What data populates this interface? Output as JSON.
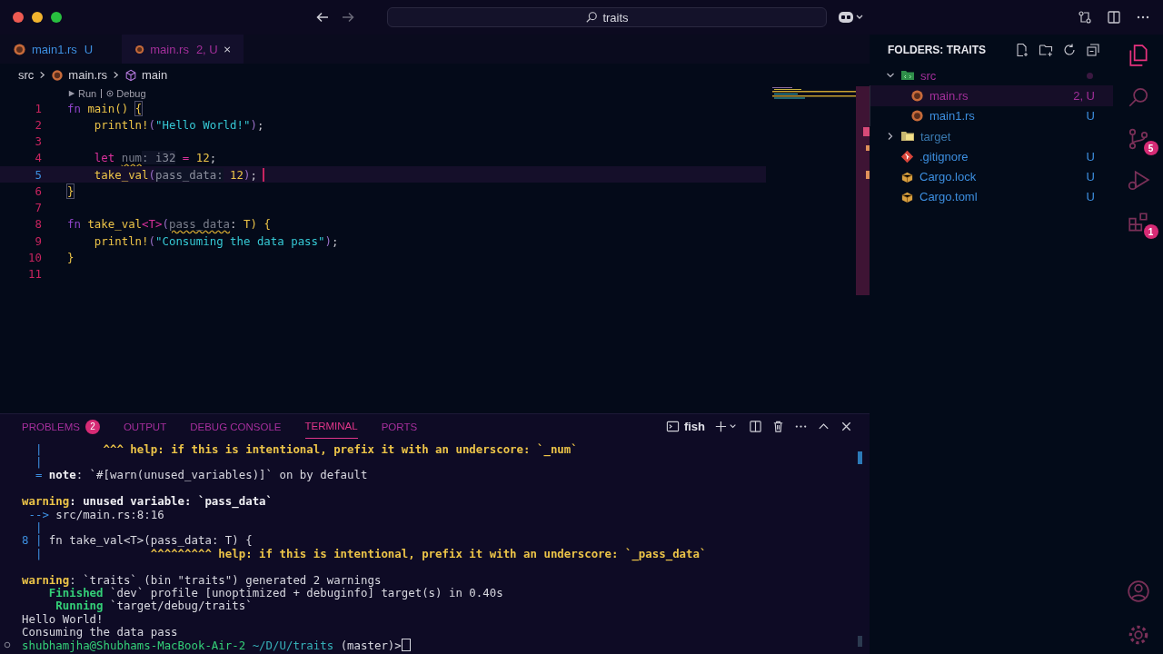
{
  "titlebar": {
    "search": "traits"
  },
  "tabs": [
    {
      "label": "main1.rs",
      "status": "U",
      "selected": false,
      "color": "#3d8fe0"
    },
    {
      "label": "main.rs",
      "status": "2, U",
      "selected": true,
      "color": "#a32f9a"
    }
  ],
  "breadcrumbs": [
    {
      "label": "src",
      "kind": "folder"
    },
    {
      "label": "main.rs",
      "kind": "rust"
    },
    {
      "label": "main",
      "kind": "symbol"
    }
  ],
  "codelens": [
    "Run",
    "Debug"
  ],
  "code": [
    {
      "number": "1",
      "current": false,
      "tokens": [
        {
          "text": "fn ",
          "kind": "kw"
        },
        {
          "text": "main",
          "kind": "fn"
        },
        {
          "text": "() ",
          "kind": "fn"
        },
        {
          "text": "{",
          "kind": "brace"
        }
      ]
    },
    {
      "number": "2",
      "current": false,
      "tokens": [
        {
          "text": "    println!",
          "kind": "fn"
        },
        {
          "text": "(",
          "kind": "paren"
        },
        {
          "text": "\"Hello World!\"",
          "kind": "str"
        },
        {
          "text": ")",
          "kind": "paren"
        },
        {
          "text": ";",
          "kind": "punct"
        }
      ]
    },
    {
      "number": "3",
      "current": false
    },
    {
      "number": "4",
      "current": false,
      "tokens": [
        {
          "text": "    let ",
          "kind": "let"
        },
        {
          "text": "num",
          "kind": "unused"
        },
        {
          "text": ": i32",
          "kind": "hint"
        },
        {
          "text": " = ",
          "kind": "let"
        },
        {
          "text": "12",
          "kind": "num"
        },
        {
          "text": ";",
          "kind": "punct"
        }
      ]
    },
    {
      "number": "5",
      "current": true,
      "tokens": [
        {
          "text": "    take_val",
          "kind": "fn"
        },
        {
          "text": "(",
          "kind": "paren"
        },
        {
          "text": "pass_data:",
          "kind": "hint"
        },
        {
          "text": " 12",
          "kind": "num"
        },
        {
          "text": ")",
          "kind": "paren"
        },
        {
          "text": ";",
          "kind": "punct"
        }
      ]
    },
    {
      "number": "6",
      "current": false,
      "tokens": [
        {
          "text": "}",
          "kind": "brace"
        }
      ]
    },
    {
      "number": "7",
      "current": false
    },
    {
      "number": "8",
      "current": false,
      "tokens": [
        {
          "text": "fn ",
          "kind": "kw"
        },
        {
          "text": "take_val",
          "kind": "fn"
        },
        {
          "text": "<T>",
          "kind": "let"
        },
        {
          "text": "(",
          "kind": "paren"
        },
        {
          "text": "pass_data",
          "kind": "unused"
        },
        {
          "text": ": ",
          "kind": "punct"
        },
        {
          "text": "T",
          "kind": "fn"
        },
        {
          "text": ") {",
          "kind": "fn"
        }
      ]
    },
    {
      "number": "9",
      "current": false,
      "tokens": [
        {
          "text": "    println!",
          "kind": "fn"
        },
        {
          "text": "(",
          "kind": "paren"
        },
        {
          "text": "\"Consuming the data pass\"",
          "kind": "str"
        },
        {
          "text": ")",
          "kind": "paren"
        },
        {
          "text": ";",
          "kind": "punct"
        }
      ]
    },
    {
      "number": "10",
      "current": false,
      "tokens": [
        {
          "text": "}",
          "kind": "fn"
        }
      ]
    },
    {
      "number": "11",
      "current": false
    }
  ],
  "explorer": {
    "title": "FOLDERS: TRAITS",
    "items": [
      {
        "name": "src",
        "kind": "folder",
        "expanded": true,
        "selected": false,
        "color": "#a32f9a",
        "children": [
          {
            "name": "main.rs",
            "kind": "rust",
            "status": "2, U",
            "selected": true,
            "color": "#a32f9a"
          },
          {
            "name": "main1.rs",
            "kind": "rust",
            "status": "U",
            "selected": false,
            "color": "#3d8fe0"
          }
        ]
      },
      {
        "name": "target",
        "kind": "folder",
        "expanded": false,
        "selected": false,
        "color": "#3a7ab0"
      },
      {
        "name": ".gitignore",
        "kind": "git",
        "status": "U",
        "selected": false,
        "color": "#3d8fe0"
      },
      {
        "name": "Cargo.lock",
        "kind": "cargo",
        "status": "U",
        "selected": false,
        "color": "#3d8fe0"
      },
      {
        "name": "Cargo.toml",
        "kind": "cargo",
        "status": "U",
        "selected": false,
        "color": "#3d8fe0"
      }
    ]
  },
  "activity": [
    {
      "kind": "explorer",
      "selected": true
    },
    {
      "kind": "search",
      "selected": false
    },
    {
      "kind": "source-control",
      "selected": false,
      "badge": "5"
    },
    {
      "kind": "run-debug",
      "selected": false
    },
    {
      "kind": "extensions",
      "selected": false,
      "badge": "1"
    }
  ],
  "panel": {
    "tabs": [
      {
        "label": "PROBLEMS",
        "badge": "2",
        "selected": false
      },
      {
        "label": "OUTPUT",
        "selected": false
      },
      {
        "label": "DEBUG CONSOLE",
        "selected": false
      },
      {
        "label": "TERMINAL",
        "selected": true
      },
      {
        "label": "PORTS",
        "selected": false
      }
    ],
    "shell": "fish",
    "terminal": [
      [
        [
          {
            "text": "  |         ",
            "kind": "blue"
          },
          {
            "text": "^^^ help: if this is intentional, prefix it with an underscore: `_num`",
            "kind": "yellow"
          }
        ],
        [
          {
            "text": "  |",
            "kind": "blue"
          }
        ],
        [
          {
            "text": "  = ",
            "kind": "blue"
          },
          {
            "text": "note",
            "kind": "bold"
          },
          {
            "text": ": `#[warn(unused_variables)]` on by default",
            "kind": "plain"
          }
        ]
      ],
      [
        [
          {
            "text": "warning",
            "kind": "yellow"
          },
          {
            "text": ": unused variable: `pass_data`",
            "kind": "bold"
          }
        ],
        [
          {
            "text": " --> ",
            "kind": "blue"
          },
          {
            "text": "src/main.rs:8:16",
            "kind": "plain"
          }
        ],
        [
          {
            "text": "  |",
            "kind": "blue"
          }
        ],
        [
          {
            "text": "8 | ",
            "kind": "blue"
          },
          {
            "text": "fn take_val<T>(pass_data: T) {",
            "kind": "plain"
          }
        ],
        [
          {
            "text": "  |                ",
            "kind": "blue"
          },
          {
            "text": "^^^^^^^^^ help: if this is intentional, prefix it with an underscore: `_pass_data`",
            "kind": "yellow"
          }
        ]
      ],
      [
        [
          {
            "text": "warning",
            "kind": "yellow"
          },
          {
            "text": ": `traits` (bin \"traits\") generated 2 warnings",
            "kind": "plain"
          }
        ],
        [
          {
            "text": "    Finished",
            "kind": "green"
          },
          {
            "text": " `dev` profile [unoptimized + debuginfo] target(s) in 0.40s",
            "kind": "plain"
          }
        ],
        [
          {
            "text": "     Running",
            "kind": "green"
          },
          {
            "text": " `target/debug/traits`",
            "kind": "plain"
          }
        ],
        [
          {
            "text": "Hello World!",
            "kind": "plain"
          }
        ],
        [
          {
            "text": "Consuming the data pass",
            "kind": "plain"
          }
        ]
      ]
    ],
    "prompt": {
      "user": "shubhamjha@Shubhams-MacBook-Air-2",
      "path": "~/D/U/traits",
      "suffix": "(master)>"
    }
  }
}
